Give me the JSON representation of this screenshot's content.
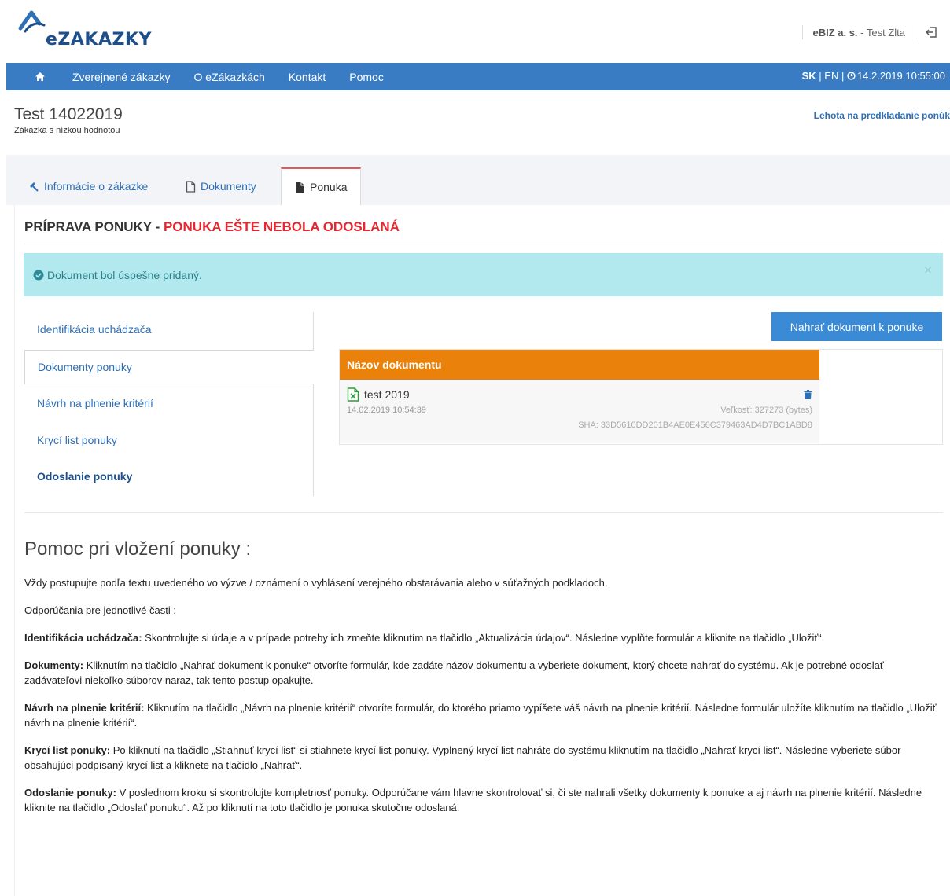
{
  "header": {
    "logo_text": "eZAKAZKY",
    "company": "eBIZ a. s.",
    "user": " - Test Zlta"
  },
  "nav": {
    "items": [
      "Zverejnené zákazky",
      "O eZákazkách",
      "Kontakt",
      "Pomoc"
    ],
    "lang_active": "SK",
    "lang_other": " | EN | ",
    "datetime": "14.2.2019 10:55:00"
  },
  "page": {
    "title": "Test 14022019",
    "subtitle": "Zákazka s nízkou hodnotou",
    "deadline_label": "Lehota na predkladanie ponúk"
  },
  "tabs": [
    "Informácie o zákazke",
    "Dokumenty",
    "Ponuka"
  ],
  "section": {
    "heading": "PRÍPRAVA PONUKY - ",
    "status": "PONUKA EŠTE NEBOLA ODOSLANÁ"
  },
  "alert": {
    "message": "Dokument bol úspešne pridaný.",
    "close": "×"
  },
  "menu": [
    "Identifikácia uchádzača",
    "Dokumenty ponuky",
    "Návrh na plnenie kritérií",
    "Krycí list ponuky",
    "Odoslanie ponuky"
  ],
  "upload_button": "Nahrať dokument k ponuke",
  "documents": {
    "column_header": "Názov dokumentu",
    "rows": [
      {
        "name": "test 2019",
        "date": "14.02.2019 10:54:39",
        "size": "Veľkosť: 327273 (bytes)",
        "sha": "SHA: 33D5610DD201B4AE0E456C379463AD4D7BC1ABD8"
      }
    ]
  },
  "help": {
    "title": "Pomoc pri vložení ponuky :",
    "intro": "Vždy postupujte podľa textu uvedeného vo výzve / oznámení o vyhlásení verejného obstarávania alebo v súťažných podkladoch.",
    "recommend": "Odporúčania pre jednotlivé časti :",
    "items": [
      {
        "label": "Identifikácia uchádzača:",
        "text": " Skontrolujte si údaje a v prípade potreby ich zmeňte kliknutím na tlačidlo „Aktualizácia údajov“. Následne vyplňte formulár a kliknite na tlačidlo „Uložiť“."
      },
      {
        "label": "Dokumenty:",
        "text": " Kliknutím na tlačidlo „Nahrať dokument k ponuke“ otvoríte formulár, kde zadáte názov dokumentu a vyberiete dokument, ktorý chcete nahrať do systému. Ak je potrebné odoslať zadávateľovi niekoľko súborov naraz, tak tento postup opakujte."
      },
      {
        "label": "Návrh na plnenie kritérií:",
        "text": " Kliknutím na tlačidlo „Návrh na plnenie kritérií“ otvoríte formulár, do ktorého priamo vypíšete váš návrh na plnenie kritérií. Následne formulár uložíte kliknutím na tlačidlo „Uložiť návrh na plnenie kritérií“."
      },
      {
        "label": "Krycí list ponuky:",
        "text": " Po kliknutí na tlačidlo „Stiahnuť krycí list“ si stiahnete krycí list ponuky. Vyplnený krycí list nahráte do systému kliknutím na tlačidlo „Nahrať krycí list“. Následne vyberiete súbor obsahujúci podpísaný krycí list a kliknete na tlačidlo „Nahrať“."
      },
      {
        "label": "Odoslanie ponuky:",
        "text": " V poslednom kroku si skontrolujte kompletnosť ponuky. Odporúčane vám hlavne skontrolovať si, či ste nahrali všetky dokumenty k ponuke a aj návrh na plnenie kritérií. Následne kliknite na tlačidlo „Odoslať ponuku“. Až po kliknutí na toto tlačidlo je ponuka skutočne odoslaná."
      }
    ]
  },
  "colors": {
    "nav": "#3a7cc3",
    "table_header": "#e9810b",
    "alert_bg": "#b2e9ee",
    "status_red": "#e8262f",
    "link": "#2f6fb6"
  }
}
